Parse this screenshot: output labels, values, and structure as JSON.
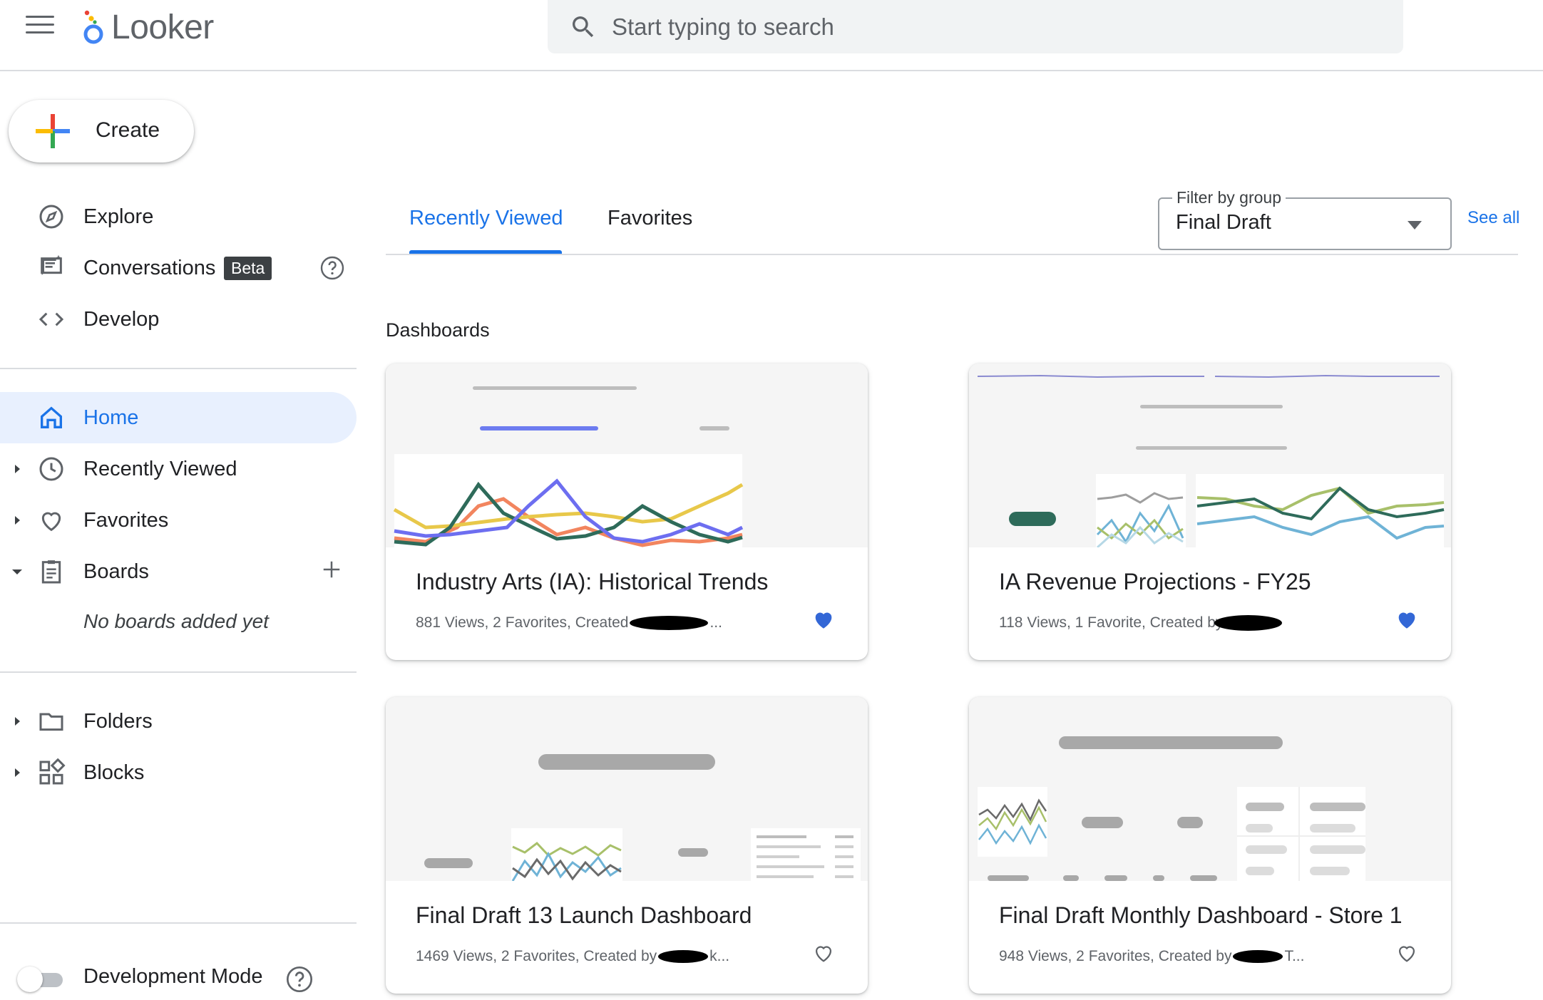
{
  "app": {
    "logo_text": "Looker"
  },
  "search": {
    "placeholder": "Start typing to search"
  },
  "sidebar": {
    "create_label": "Create",
    "nav_top": [
      {
        "label": "Explore",
        "icon": "compass-icon"
      },
      {
        "label": "Conversations",
        "icon": "conversation-icon",
        "badge": "Beta"
      },
      {
        "label": "Develop",
        "icon": "code-icon"
      }
    ],
    "nav_main": [
      {
        "label": "Home",
        "icon": "home-icon",
        "active": true
      },
      {
        "label": "Recently Viewed",
        "icon": "clock-icon"
      },
      {
        "label": "Favorites",
        "icon": "heart-outline-icon"
      },
      {
        "label": "Boards",
        "icon": "clipboard-icon"
      }
    ],
    "boards_empty": "No boards added yet",
    "nav_bottom": [
      {
        "label": "Folders",
        "icon": "folder-icon"
      },
      {
        "label": "Blocks",
        "icon": "blocks-icon"
      }
    ],
    "dev_mode_label": "Development Mode",
    "dev_mode_on": false
  },
  "main": {
    "tabs": [
      {
        "label": "Recently Viewed",
        "active": true
      },
      {
        "label": "Favorites",
        "active": false
      }
    ],
    "filter": {
      "legend": "Filter by group",
      "value": "Final Draft"
    },
    "see_all": "See all",
    "section_title": "Dashboards",
    "cards": [
      {
        "title": "Industry Arts (IA): Historical Trends",
        "meta": "881 Views, 2 Favorites, Created",
        "meta_tail": "...",
        "favorited": true
      },
      {
        "title": "IA Revenue Projections - FY25",
        "meta": "118 Views, 1 Favorite, Created by W",
        "meta_tail": "",
        "favorited": true
      },
      {
        "title": "Final Draft 13 Launch Dashboard",
        "meta": "1469 Views, 2 Favorites, Created by",
        "meta_tail": "k...",
        "favorited": false
      },
      {
        "title": "Final Draft Monthly Dashboard - Store 1",
        "meta": "948 Views, 2 Favorites, Created by",
        "meta_tail": "T...",
        "favorited": false
      }
    ]
  },
  "colors": {
    "accent": "#1a73e8",
    "active_nav_bg": "#e8f0fe",
    "heart_filled": "#3367d6",
    "chart_green": "#2e6b5a",
    "chart_orange": "#f2855f",
    "chart_purple": "#6d6ef0",
    "chart_yellow": "#e8c84a",
    "chart_olive": "#a8c06a",
    "chart_blue": "#6fb3d6"
  }
}
